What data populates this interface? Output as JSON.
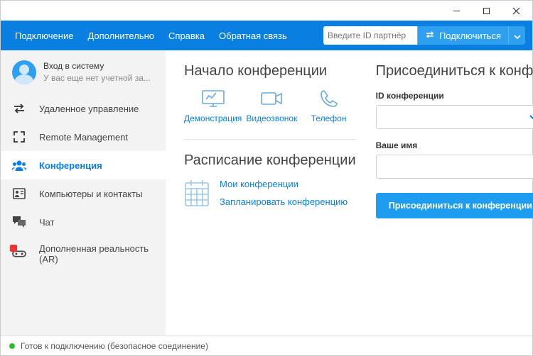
{
  "menubar": {
    "items": [
      "Подключение",
      "Дополнительно",
      "Справка",
      "Обратная связь"
    ],
    "partner_placeholder": "Введите ID партнёр",
    "connect_label": "Подключиться"
  },
  "profile": {
    "line1": "Вход в систему",
    "line2": "У вас еще нет учетной за..."
  },
  "nav": {
    "items": [
      "Удаленное управление",
      "Remote Management",
      "Конференция",
      "Компьютеры и контакты",
      "Чат",
      "Дополненная реальность (AR)"
    ],
    "active_index": 2
  },
  "start": {
    "heading": "Начало конференции",
    "options": [
      "Демонстрация",
      "Видеозвонок",
      "Телефон"
    ]
  },
  "schedule": {
    "heading": "Расписание конференции",
    "links": [
      "Мои конференции",
      "Запланировать конференцию"
    ]
  },
  "join": {
    "heading": "Присоединиться к конф...",
    "id_label": "ID конференции",
    "name_label": "Ваше имя",
    "button": "Присоединиться к конференции"
  },
  "status": {
    "text": "Готов к подключению (безопасное соединение)"
  }
}
